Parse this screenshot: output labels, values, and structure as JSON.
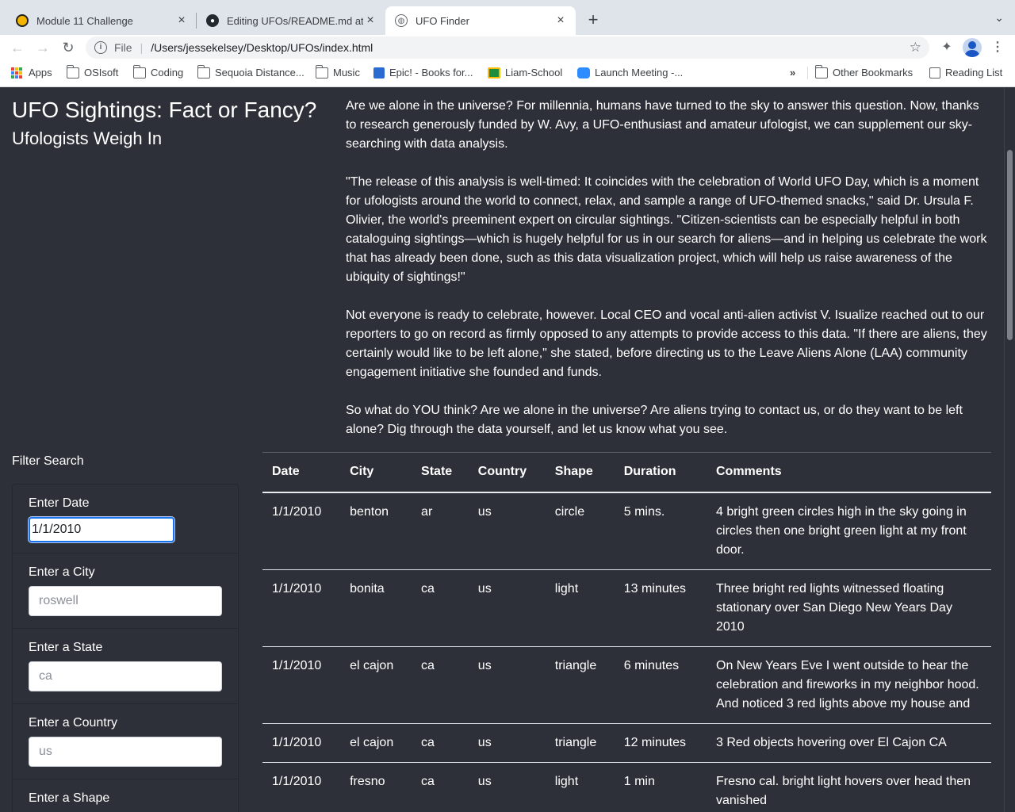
{
  "browser": {
    "tabs": [
      {
        "title": "Module 11 Challenge",
        "close": "×"
      },
      {
        "title": "Editing UFOs/README.md at main",
        "close": "×"
      },
      {
        "title": "UFO Finder",
        "close": "×"
      }
    ],
    "new_tab": "+",
    "tab_menu": "⌄",
    "address": {
      "scheme": "File",
      "path": "/Users/jessekelsey/Desktop/UFOs/index.html"
    },
    "bookmarks": [
      {
        "label": "Apps",
        "icon": "apps-icon"
      },
      {
        "label": "OSIsoft",
        "icon": "folder-icon"
      },
      {
        "label": "Coding",
        "icon": "folder-icon"
      },
      {
        "label": "Sequoia Distance...",
        "icon": "folder-icon"
      },
      {
        "label": "Music",
        "icon": "folder-icon"
      },
      {
        "label": "Epic! - Books for...",
        "icon": "epic-icon"
      },
      {
        "label": "Liam-School",
        "icon": "classroom-icon"
      },
      {
        "label": "Launch Meeting -...",
        "icon": "zoom-icon"
      }
    ],
    "bookmarks_overflow": "»",
    "other_bookmarks": "Other Bookmarks",
    "reading_list": "Reading List",
    "colors": {
      "tabstrip": "#dfe3ea",
      "toolbar": "#ffffff",
      "focus": "#1a73e8"
    }
  },
  "page": {
    "title": "UFO Sightings: Fact or Fancy?",
    "subtitle": "Ufologists Weigh In",
    "article": [
      "Are we alone in the universe? For millennia, humans have turned to the sky to answer this question. Now, thanks to research generously funded by W. Avy, a UFO-enthusiast and amateur ufologist, we can supplement our sky-searching with data analysis.",
      "\"The release of this analysis is well-timed: It coincides with the celebration of World UFO Day, which is a moment for ufologists around the world to connect, relax, and sample a range of UFO-themed snacks,\" said Dr. Ursula F. Olivier, the world's preeminent expert on circular sightings. \"Citizen-scientists can be especially helpful in both cataloguing sightings—which is hugely helpful for us in our search for aliens—and in helping us celebrate the work that has already been done, such as this data visualization project, which will help us raise awareness of the ubiquity of sightings!\"",
      "Not everyone is ready to celebrate, however. Local CEO and vocal anti-alien activist V. Isualize reached out to our reporters to go on record as firmly opposed to any attempts to provide access to this data. \"If there are aliens, they certainly would like to be left alone,\" she stated, before directing us to the Leave Aliens Alone (LAA) community engagement initiative she founded and funds.",
      "So what do YOU think? Are we alone in the universe? Are aliens trying to contact us, or do they want to be left alone? Dig through the data yourself, and let us know what you see."
    ],
    "colors": {
      "background": "#2d3038",
      "text": "#ffffff"
    }
  },
  "filters": {
    "heading": "Filter Search",
    "items": [
      {
        "label": "Enter Date",
        "value": "1/1/2010",
        "placeholder": ""
      },
      {
        "label": "Enter a City",
        "value": "",
        "placeholder": "roswell"
      },
      {
        "label": "Enter a State",
        "value": "",
        "placeholder": "ca"
      },
      {
        "label": "Enter a Country",
        "value": "",
        "placeholder": "us"
      },
      {
        "label": "Enter a Shape",
        "value": "",
        "placeholder": ""
      }
    ]
  },
  "table": {
    "headers": [
      "Date",
      "City",
      "State",
      "Country",
      "Shape",
      "Duration",
      "Comments"
    ],
    "rows": [
      [
        "1/1/2010",
        "benton",
        "ar",
        "us",
        "circle",
        "5 mins.",
        "4 bright green circles high in the sky going in circles then one bright green light at my front door."
      ],
      [
        "1/1/2010",
        "bonita",
        "ca",
        "us",
        "light",
        "13 minutes",
        "Three bright red lights witnessed floating stationary over San Diego New Years Day 2010"
      ],
      [
        "1/1/2010",
        "el cajon",
        "ca",
        "us",
        "triangle",
        "6 minutes",
        "On New Years Eve I went outside to hear the celebration and fireworks in my neighbor hood. And noticed 3 red lights above my house and"
      ],
      [
        "1/1/2010",
        "el cajon",
        "ca",
        "us",
        "triangle",
        "12 minutes",
        "3 Red objects hovering over El Cajon CA"
      ],
      [
        "1/1/2010",
        "fresno",
        "ca",
        "us",
        "light",
        "1 min",
        "Fresno cal. bright light hovers over head then vanished"
      ]
    ]
  }
}
